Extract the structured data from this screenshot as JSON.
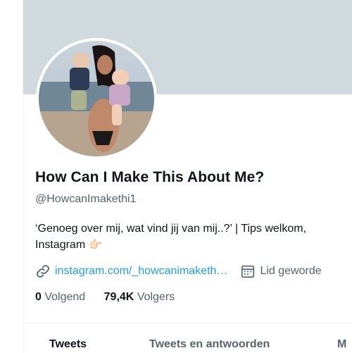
{
  "profile": {
    "display_name": "How Can I Make This About Me?",
    "handle": "@HowcanImakethi1",
    "bio_line1": "‘Genoeg over mij, wat vind jij van mij..?’ | Tips welkom, ",
    "bio_line2": "Instagram",
    "bio_emoji": "👉🏻",
    "link_text": "instagram.com/_howcanimaketh…",
    "joined_text": "Lid geworde",
    "following_count": "0",
    "following_label": "Volgend",
    "followers_count": "79,4K",
    "followers_label": "Volgers"
  },
  "tabs": [
    {
      "label": "Tweets",
      "active": true
    },
    {
      "label": "Tweets en antwoorden",
      "active": false
    },
    {
      "label": "M",
      "active": false
    }
  ],
  "colors": {
    "banner": "#cfd9de",
    "link": "#1d9bf0",
    "secondary_text": "#536471",
    "primary_text": "#0f1419"
  },
  "icons": {
    "link": "link-icon",
    "calendar": "calendar-icon"
  }
}
